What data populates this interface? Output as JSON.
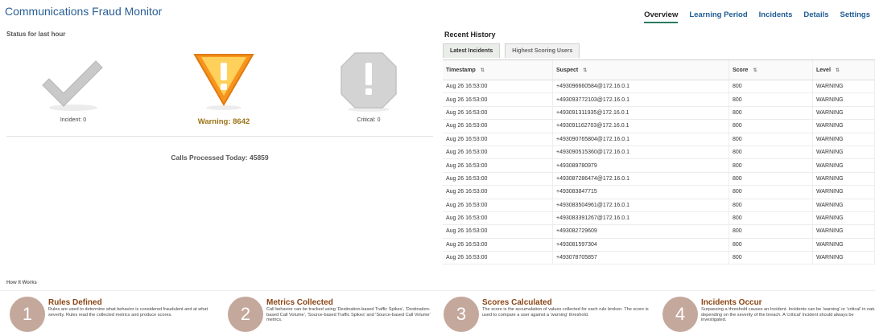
{
  "app": {
    "title": "Communications Fraud Monitor"
  },
  "nav": [
    "Overview",
    "Learning Period",
    "Incidents",
    "Details",
    "Settings"
  ],
  "status": {
    "title": "Status for last hour",
    "incident_label": "Incident: 0",
    "warning_label": "Warning: 8642",
    "critical_label": "Critical: 0",
    "calls_processed": "Calls Processed Today: 45859"
  },
  "history": {
    "title": "Recent History",
    "tabs": [
      "Latest Incidents",
      "Highest Scoring Users"
    ],
    "columns": [
      "Timestamp",
      "Suspect",
      "Score",
      "Level"
    ],
    "rows": [
      [
        "Aug 26 16:53:00",
        "+493096660584@172.16.0.1",
        "800",
        "WARNING"
      ],
      [
        "Aug 26 16:53:00",
        "+493093772103@172.16.0.1",
        "800",
        "WARNING"
      ],
      [
        "Aug 26 16:53:00",
        "+493091311935@172.16.0.1",
        "800",
        "WARNING"
      ],
      [
        "Aug 26 16:53:00",
        "+493091162703@172.16.0.1",
        "800",
        "WARNING"
      ],
      [
        "Aug 26 16:53:00",
        "+493090765804@172.16.0.1",
        "800",
        "WARNING"
      ],
      [
        "Aug 26 16:53:00",
        "+493090515360@172.16.0.1",
        "800",
        "WARNING"
      ],
      [
        "Aug 26 16:53:00",
        "+493089780979",
        "800",
        "WARNING"
      ],
      [
        "Aug 26 16:53:00",
        "+493087286474@172.16.0.1",
        "800",
        "WARNING"
      ],
      [
        "Aug 26 16:53:00",
        "+493083847715",
        "800",
        "WARNING"
      ],
      [
        "Aug 26 16:53:00",
        "+493083504961@172.16.0.1",
        "800",
        "WARNING"
      ],
      [
        "Aug 26 16:53:00",
        "+493083391267@172.16.0.1",
        "800",
        "WARNING"
      ],
      [
        "Aug 26 16:53:00",
        "+493082729609",
        "800",
        "WARNING"
      ],
      [
        "Aug 26 16:53:00",
        "+493081597304",
        "800",
        "WARNING"
      ],
      [
        "Aug 26 16:53:00",
        "+493078705857",
        "800",
        "WARNING"
      ]
    ]
  },
  "how_it_works": {
    "title": "How It Works",
    "steps": [
      {
        "num": "1",
        "title": "Rules Defined",
        "desc": "Rules are used to determine what behavior is considered fraudulent and at what severity. Rules read the collected metrics and produce scores."
      },
      {
        "num": "2",
        "title": "Metrics Collected",
        "desc": "Call behavior can be tracked using 'Destination-based Traffic Spikes', 'Destination-based Call Volume', 'Source-based Traffic Spikes' and 'Source-based Call Volume' metrics."
      },
      {
        "num": "3",
        "title": "Scores Calculated",
        "desc": "The score is the accumulation of values collected for each rule broken. The score is used to compare a user against a 'warning' threshold."
      },
      {
        "num": "4",
        "title": "Incidents Occur",
        "desc": "Surpassing a threshold causes an Incident. Incidents can be 'warning' or 'critical' in nature depending on the severity of the breach. A 'critical' Incident should always be investigated."
      }
    ]
  },
  "colors": {
    "accent": "#2a7b5e",
    "title": "#2a5f95",
    "warning": "#f7941d",
    "step_circle": "#c4a89c",
    "step_title": "#8a4513"
  }
}
